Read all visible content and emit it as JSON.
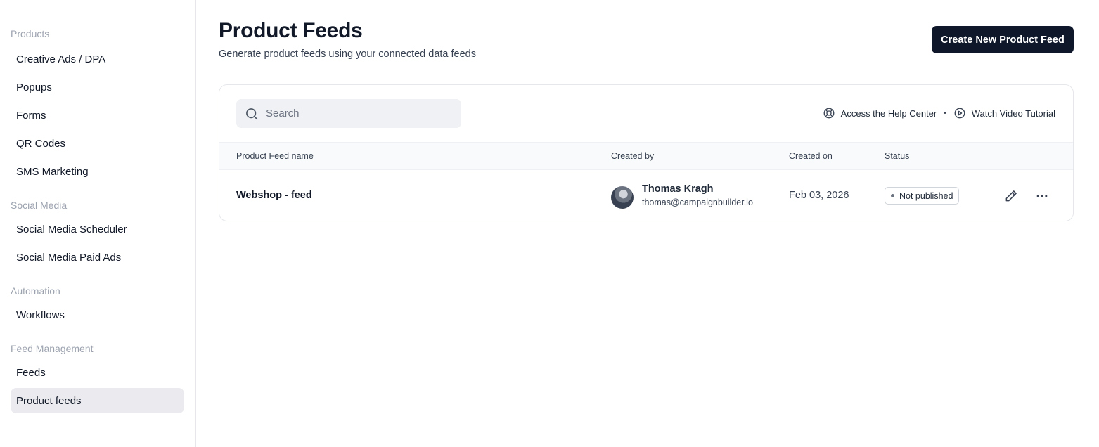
{
  "sidebar": {
    "sections": [
      {
        "title": "Products",
        "items": [
          "Creative Ads / DPA",
          "Popups",
          "Forms",
          "QR Codes",
          "SMS Marketing"
        ]
      },
      {
        "title": "Social Media",
        "items": [
          "Social Media Scheduler",
          "Social Media Paid Ads"
        ]
      },
      {
        "title": "Automation",
        "items": [
          "Workflows"
        ]
      },
      {
        "title": "Feed Management",
        "items": [
          "Feeds",
          "Product feeds"
        ]
      }
    ],
    "active_item": "Product feeds"
  },
  "header": {
    "title": "Product Feeds",
    "subtitle": "Generate product feeds using your connected data feeds",
    "create_button": "Create New Product Feed"
  },
  "search": {
    "placeholder": "Search",
    "value": ""
  },
  "help": {
    "help_center": "Access the Help Center",
    "separator": "•",
    "video_tutorial": "Watch Video Tutorial"
  },
  "table": {
    "columns": [
      "Product Feed name",
      "Created by",
      "Created on",
      "Status"
    ],
    "rows": [
      {
        "name": "Webshop - feed",
        "creator_name": "Thomas Kragh",
        "creator_email": "thomas@campaignbuilder.io",
        "created_on": "Feb 03, 2026",
        "status": "Not published"
      }
    ]
  },
  "icons": {
    "search": "search-icon",
    "help": "lifebuoy-icon",
    "video": "play-circle-icon",
    "edit": "pencil-icon",
    "more": "more-horizontal-icon"
  },
  "colors": {
    "primary": "#0f172a",
    "active_bg": "#ebebef",
    "muted": "#9ca3af"
  }
}
